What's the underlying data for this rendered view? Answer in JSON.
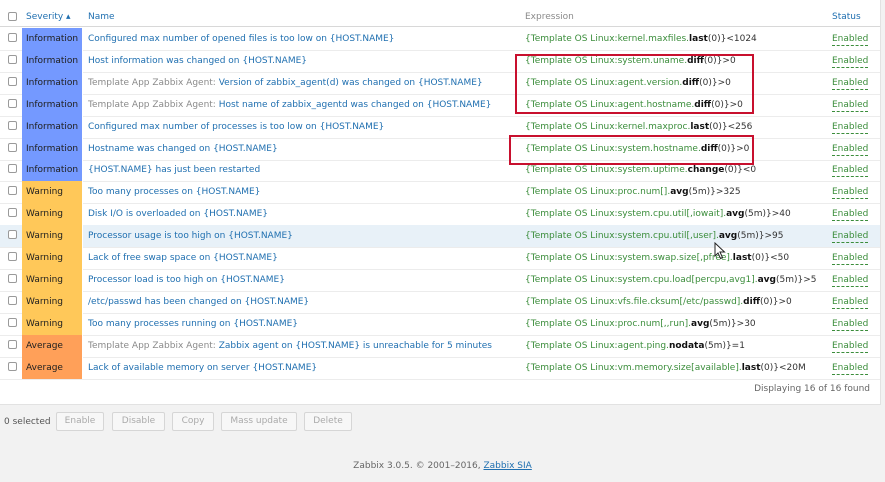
{
  "header": {
    "severity": "Severity ▴",
    "name": "Name",
    "expression": "Expression",
    "status": "Status"
  },
  "colors": {
    "Information": "#7499ff",
    "Warning": "#ffc859",
    "Average": "#ffa059"
  },
  "rows": [
    {
      "severity": "Information",
      "name_prefix": "",
      "name": "Configured max number of opened files is too low on {HOST.NAME}",
      "expr_key": "{Template OS Linux:kernel.maxfiles.",
      "expr_fn": "last",
      "expr_rest": "(0)}<1024",
      "status": "Enabled"
    },
    {
      "severity": "Information",
      "name_prefix": "",
      "name": "Host information was changed on {HOST.NAME}",
      "expr_key": "{Template OS Linux:system.uname.",
      "expr_fn": "diff",
      "expr_rest": "(0)}>0",
      "status": "Enabled"
    },
    {
      "severity": "Information",
      "name_prefix": "Template App Zabbix Agent: ",
      "name": "Version of zabbix_agent(d) was changed on {HOST.NAME}",
      "expr_key": "{Template OS Linux:agent.version.",
      "expr_fn": "diff",
      "expr_rest": "(0)}>0",
      "status": "Enabled"
    },
    {
      "severity": "Information",
      "name_prefix": "Template App Zabbix Agent: ",
      "name": "Host name of zabbix_agentd was changed on {HOST.NAME}",
      "expr_key": "{Template OS Linux:agent.hostname.",
      "expr_fn": "diff",
      "expr_rest": "(0)}>0",
      "status": "Enabled"
    },
    {
      "severity": "Information",
      "name_prefix": "",
      "name": "Configured max number of processes is too low on {HOST.NAME}",
      "expr_key": "{Template OS Linux:kernel.maxproc.",
      "expr_fn": "last",
      "expr_rest": "(0)}<256",
      "status": "Enabled"
    },
    {
      "severity": "Information",
      "name_prefix": "",
      "name": "Hostname was changed on {HOST.NAME}",
      "expr_key": "{Template OS Linux:system.hostname.",
      "expr_fn": "diff",
      "expr_rest": "(0)}>0",
      "status": "Enabled"
    },
    {
      "severity": "Information",
      "name_prefix": "",
      "name": "{HOST.NAME} has just been restarted",
      "expr_key": "{Template OS Linux:system.uptime.",
      "expr_fn": "change",
      "expr_rest": "(0)}<0",
      "status": "Enabled"
    },
    {
      "severity": "Warning",
      "name_prefix": "",
      "name": "Too many processes on {HOST.NAME}",
      "expr_key": "{Template OS Linux:proc.num[].",
      "expr_fn": "avg",
      "expr_rest": "(5m)}>325",
      "status": "Enabled"
    },
    {
      "severity": "Warning",
      "name_prefix": "",
      "name": "Disk I/O is overloaded on {HOST.NAME}",
      "expr_key": "{Template OS Linux:system.cpu.util[,iowait].",
      "expr_fn": "avg",
      "expr_rest": "(5m)}>40",
      "status": "Enabled"
    },
    {
      "severity": "Warning",
      "name_prefix": "",
      "name": "Processor usage is too high on {HOST.NAME}",
      "expr_key": "{Template OS Linux:system.cpu.util[,user].",
      "expr_fn": "avg",
      "expr_rest": "(5m)}>95",
      "status": "Enabled"
    },
    {
      "severity": "Warning",
      "name_prefix": "",
      "name": "Lack of free swap space on {HOST.NAME}",
      "expr_key": "{Template OS Linux:system.swap.size[,pfree].",
      "expr_fn": "last",
      "expr_rest": "(0)}<50",
      "status": "Enabled"
    },
    {
      "severity": "Warning",
      "name_prefix": "",
      "name": "Processor load is too high on {HOST.NAME}",
      "expr_key": "{Template OS Linux:system.cpu.load[percpu,avg1].",
      "expr_fn": "avg",
      "expr_rest": "(5m)}>5",
      "status": "Enabled"
    },
    {
      "severity": "Warning",
      "name_prefix": "",
      "name": "/etc/passwd has been changed on {HOST.NAME}",
      "expr_key": "{Template OS Linux:vfs.file.cksum[/etc/passwd].",
      "expr_fn": "diff",
      "expr_rest": "(0)}>0",
      "status": "Enabled"
    },
    {
      "severity": "Warning",
      "name_prefix": "",
      "name": "Too many processes running on {HOST.NAME}",
      "expr_key": "{Template OS Linux:proc.num[,,run].",
      "expr_fn": "avg",
      "expr_rest": "(5m)}>30",
      "status": "Enabled"
    },
    {
      "severity": "Average",
      "name_prefix": "Template App Zabbix Agent: ",
      "name": "Zabbix agent on {HOST.NAME} is unreachable for 5 minutes",
      "expr_key": "{Template OS Linux:agent.ping.",
      "expr_fn": "nodata",
      "expr_rest": "(5m)}=1",
      "status": "Enabled"
    },
    {
      "severity": "Average",
      "name_prefix": "",
      "name": "Lack of available memory on server {HOST.NAME}",
      "expr_key": "{Template OS Linux:vm.memory.size[available].",
      "expr_fn": "last",
      "expr_rest": "(0)}<20M",
      "status": "Enabled"
    }
  ],
  "displaying": "Displaying 16 of 16 found",
  "footer": {
    "selected": "0 selected",
    "buttons": [
      "Enable",
      "Disable",
      "Copy",
      "Mass update",
      "Delete"
    ]
  },
  "copyright": {
    "text": "Zabbix 3.0.5. © 2001–2016, ",
    "link": "Zabbix SIA"
  }
}
